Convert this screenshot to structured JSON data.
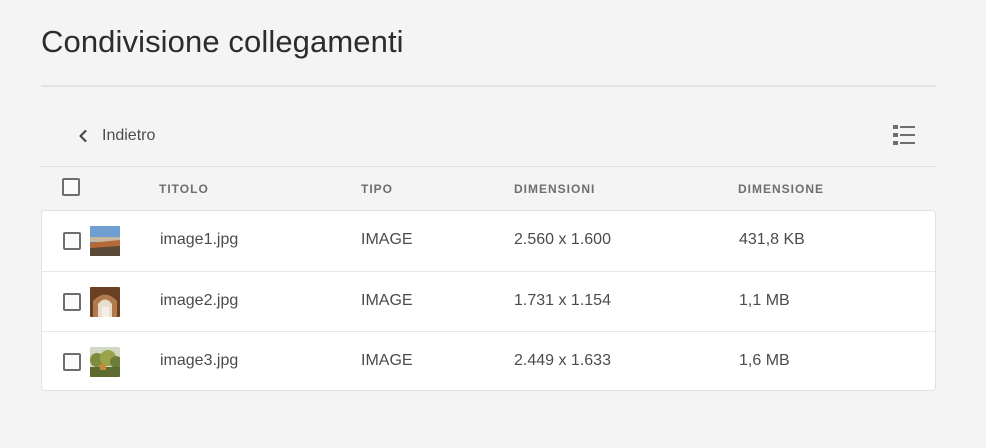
{
  "page": {
    "title": "Condivisione collegamenti"
  },
  "toolbar": {
    "back_label": "Indietro",
    "back_icon": "chevron-left-icon",
    "view_icon": "list-view-icon"
  },
  "table": {
    "columns": [
      "TITOLO",
      "TIPO",
      "DIMENSIONI",
      "DIMENSIONE"
    ],
    "rows": [
      {
        "title": "image1.jpg",
        "type": "IMAGE",
        "dimensions": "2.560 x 1.600",
        "size": "431,8 KB",
        "thumb": "landscape-thumbnail"
      },
      {
        "title": "image2.jpg",
        "type": "IMAGE",
        "dimensions": "1.731 x 1.154",
        "size": "1,1 MB",
        "thumb": "arch-thumbnail"
      },
      {
        "title": "image3.jpg",
        "type": "IMAGE",
        "dimensions": "2.449 x 1.633",
        "size": "1,6 MB",
        "thumb": "trees-thumbnail"
      }
    ]
  },
  "colors": {
    "background": "#f4f4f4",
    "table_bg": "#ffffff",
    "border": "#e1e1e1",
    "text": "#4b4b4b"
  }
}
